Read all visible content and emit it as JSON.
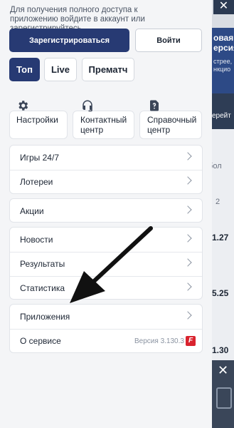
{
  "background": {
    "promo_line1": "овая",
    "promo_line2": "ерсия",
    "promo_line3": "стрее,",
    "promo_line4": "нкцио",
    "more_link": "ерейт",
    "sport_label": "тбол",
    "col_label": "2",
    "odds": [
      "1.27",
      "5.25",
      "1.30"
    ],
    "close_glyph": "✕"
  },
  "drawer": {
    "close_glyph": "✕",
    "notice": "Для получения полного доступа к приложению войдите в аккаунт или зарегистрируйтесь",
    "register_label": "Зарегистрироваться",
    "login_label": "Войти",
    "tabs": [
      {
        "label": "Топ"
      },
      {
        "label": "Live"
      },
      {
        "label": "Прематч"
      }
    ],
    "tiles": [
      {
        "label": "Настройки",
        "icon": "gear-icon"
      },
      {
        "label": "Контактный центр",
        "icon": "headset-icon"
      },
      {
        "label": "Справочный центр",
        "icon": "help-doc-icon"
      }
    ],
    "group1": [
      {
        "label": "Игры 24/7"
      },
      {
        "label": "Лотереи"
      }
    ],
    "group2": [
      {
        "label": "Акции"
      }
    ],
    "group3": [
      {
        "label": "Новости"
      },
      {
        "label": "Результаты"
      },
      {
        "label": "Статистика"
      }
    ],
    "group4": [
      {
        "label": "Приложения"
      },
      {
        "label": "О сервисе",
        "version": "Версия 3.130.3",
        "badge": "F"
      }
    ]
  },
  "colors": {
    "primary": "#273a73",
    "badge_red": "#d9232e"
  }
}
